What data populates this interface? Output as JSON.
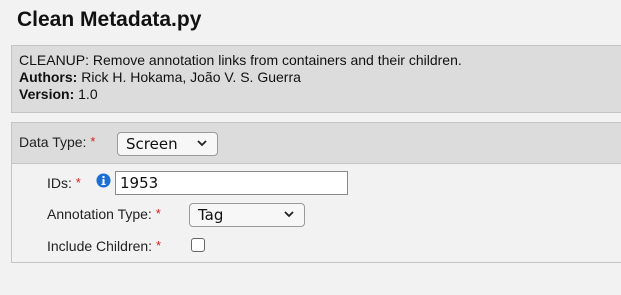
{
  "script": {
    "title": "Clean Metadata.py",
    "description": "CLEANUP: Remove annotation links from containers and their children.",
    "authors_label": "Authors:",
    "authors_value": " Rick H. Hokama, João V. S. Guerra",
    "version_label": "Version:",
    "version_value": " 1.0"
  },
  "form": {
    "required_marker": "*",
    "data_type": {
      "label": "Data Type: ",
      "value": "Screen"
    },
    "ids": {
      "label": "IDs: ",
      "value": "1953"
    },
    "annotation_type": {
      "label": "Annotation Type: ",
      "value": "Tag"
    },
    "include_children": {
      "label": "Include Children: ",
      "checked": false
    }
  },
  "colors": {
    "required": "#d42020",
    "info_icon": "#1a6fd6"
  },
  "icons": {
    "info": "info-circle-icon",
    "dropdown": "chevron-down-icon"
  }
}
